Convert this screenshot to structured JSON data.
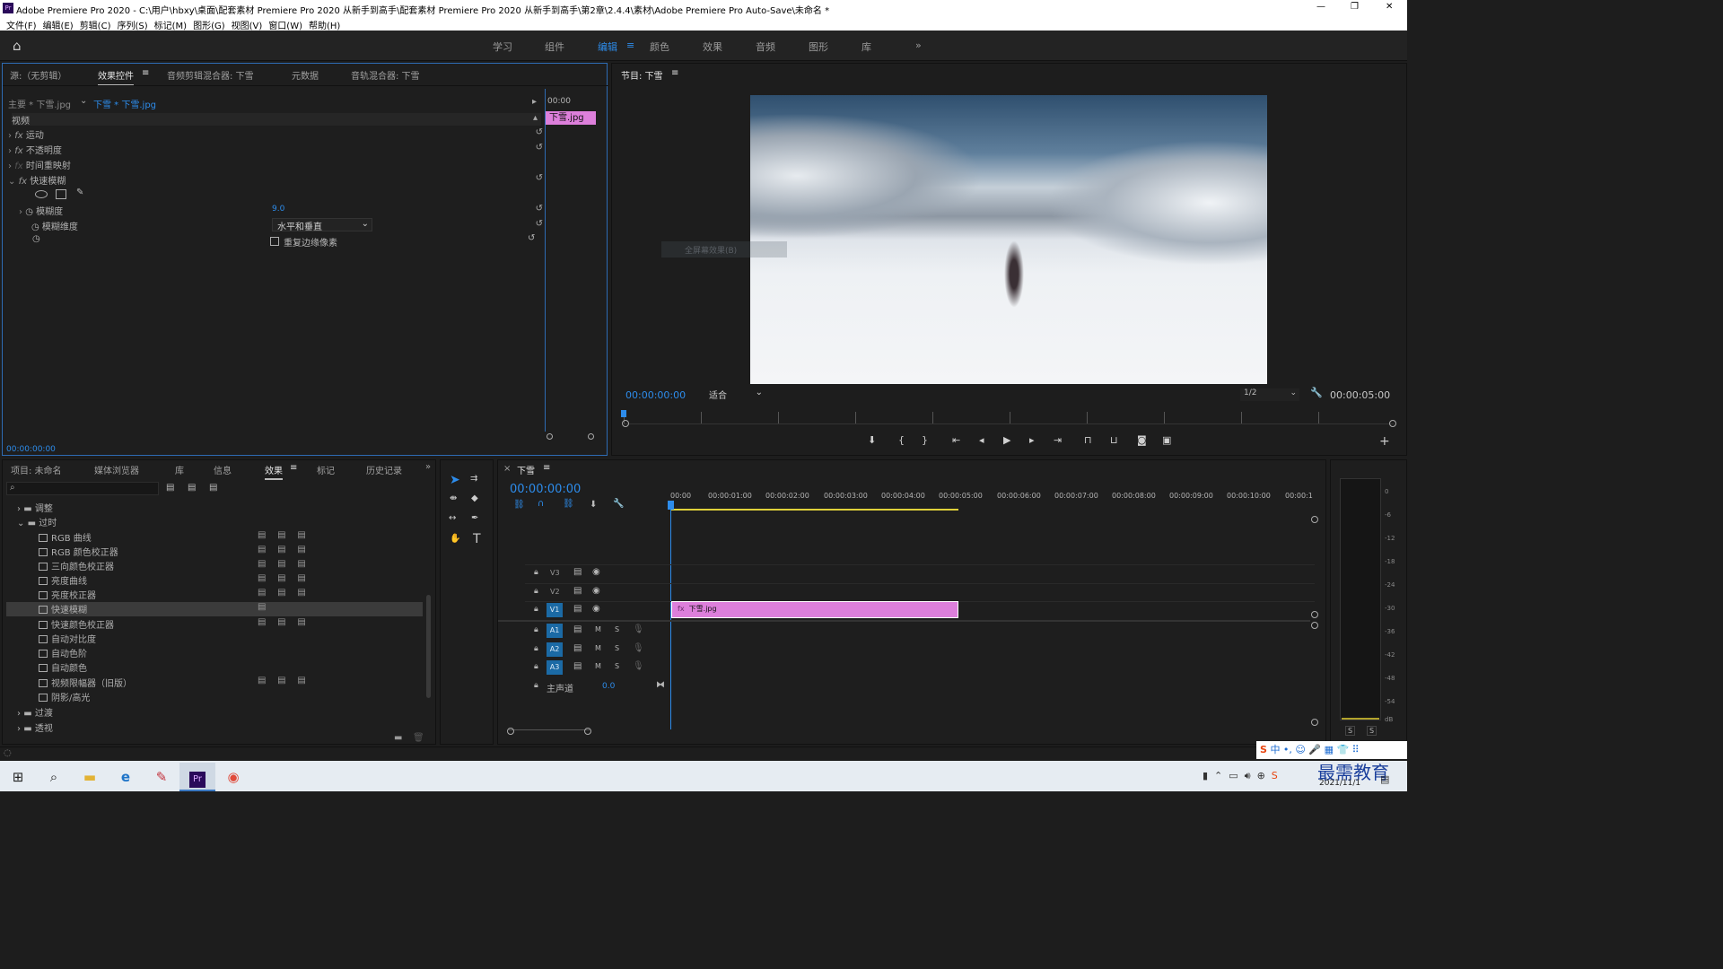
{
  "window": {
    "title": "Adobe Premiere Pro 2020 - C:\\用户\\hbxy\\桌面\\配套素材 Premiere Pro 2020 从新手到高手\\配套素材 Premiere Pro 2020 从新手到高手\\第2章\\2.4.4\\素材\\Adobe Premiere Pro Auto-Save\\未命名 *",
    "controls": [
      "—",
      "❐",
      "✕"
    ]
  },
  "menu": [
    "文件(F)",
    "编辑(E)",
    "剪辑(C)",
    "序列(S)",
    "标记(M)",
    "图形(G)",
    "视图(V)",
    "窗口(W)",
    "帮助(H)"
  ],
  "workspaces": [
    "学习",
    "组件",
    "编辑",
    "颜色",
    "效果",
    "音频",
    "图形",
    "库"
  ],
  "active_workspace": "编辑",
  "source_tabs": [
    "源:（无剪辑）",
    "效果控件",
    "音频剪辑混合器: 下雪",
    "元数据",
    "音轨混合器: 下雪"
  ],
  "effect_controls": {
    "master": "主要 * 下雪.jpg",
    "clip": "下雪 * 下雪.jpg",
    "time_head": "00:00",
    "clip_label": "下雪.jpg",
    "section": "视频",
    "effects": [
      "运动",
      "不透明度",
      "时间重映射",
      "快速模糊"
    ],
    "props": [
      {
        "label": "模糊度",
        "value": "9.0"
      },
      {
        "label": "模糊维度",
        "value": "水平和垂直"
      }
    ],
    "checkbox_label": "重复边缘像素",
    "footer_time": "00:00:00:00"
  },
  "program": {
    "tab": "节目: 下雪",
    "time_left": "00:00:00:00",
    "fit": "适合",
    "quality": "1/2",
    "time_right": "00:00:05:00",
    "ghost": "全屏幕效果(B)"
  },
  "project_tabs": [
    "项目: 未命名",
    "媒体浏览器",
    "库",
    "信息",
    "效果",
    "标记",
    "历史记录"
  ],
  "effects_tree": {
    "folders_top": [
      "调整",
      "过时"
    ],
    "items": [
      "RGB 曲线",
      "RGB 颜色校正器",
      "三向颜色校正器",
      "亮度曲线",
      "亮度校正器",
      "快速模糊",
      "快速颜色校正器",
      "自动对比度",
      "自动色阶",
      "自动颜色",
      "视频限幅器（旧版）",
      "阴影/高光"
    ],
    "folders_bottom": [
      "过渡",
      "透视"
    ]
  },
  "timeline": {
    "tab": "下雪",
    "time": "00:00:00:00",
    "ruler": [
      "00:00",
      "00:00:01:00",
      "00:00:02:00",
      "00:00:03:00",
      "00:00:04:00",
      "00:00:05:00",
      "00:00:06:00",
      "00:00:07:00",
      "00:00:08:00",
      "00:00:09:00",
      "00:00:10:00",
      "00:00:1"
    ],
    "video_tracks": [
      "V3",
      "V2",
      "V1"
    ],
    "audio_tracks": [
      "A1",
      "A2",
      "A3"
    ],
    "master": "主声道",
    "master_val": "0.0",
    "clip": "下雪.jpg"
  },
  "meter": {
    "scale": [
      "0",
      "-6",
      "-12",
      "-18",
      "-24",
      "-30",
      "-36",
      "-42",
      "-48",
      "-54",
      "dB"
    ],
    "solo": [
      "S",
      "S"
    ]
  },
  "taskbar": {
    "date": "2021/11/1",
    "watermark": "最需教育",
    "ime": "中"
  }
}
